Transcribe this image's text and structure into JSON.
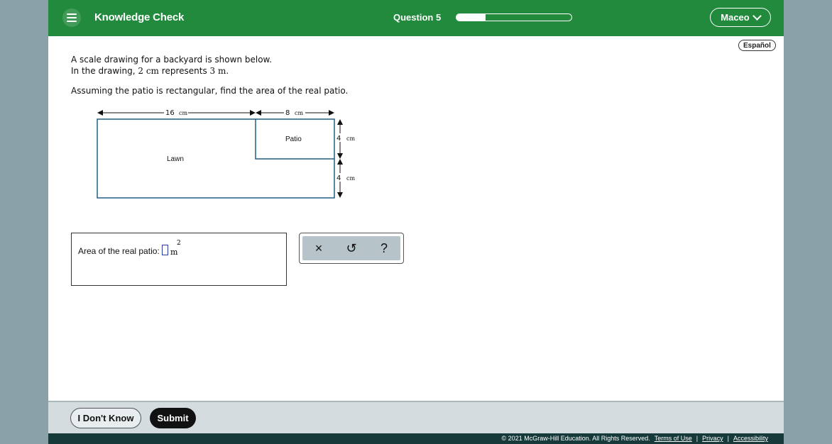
{
  "header": {
    "title": "Knowledge Check",
    "question_label": "Question 5",
    "progress": 0.25,
    "user_name": "Maceo"
  },
  "language_button": "Español",
  "problem": {
    "line1": "A scale drawing for a backyard is shown below.",
    "line2_prefix": "In the drawing,",
    "scale_drawing": "2 cm",
    "line2_middle": "represents",
    "scale_real": "3 m",
    "line2_suffix": ".",
    "question": "Assuming the patio is rectangular, find the area of the real patio."
  },
  "diagram": {
    "lawn_label": "Lawn",
    "patio_label": "Patio",
    "width_left_value": "16",
    "width_right_value": "8",
    "height_top_value": "4",
    "height_bottom_value": "4",
    "unit": "cm"
  },
  "answer": {
    "label": "Area of the real patio:",
    "value": "",
    "unit": "m",
    "exponent": "2"
  },
  "tools": {
    "clear": "×",
    "undo": "↺",
    "help": "?"
  },
  "footer": {
    "dont_know": "I Don't Know",
    "submit": "Submit",
    "copyright": "© 2021 McGraw-Hill Education. All Rights Reserved.",
    "terms": "Terms of Use",
    "privacy": "Privacy",
    "accessibility": "Accessibility"
  },
  "colors": {
    "header": "#228a3c",
    "diagram_stroke": "#1f5f86"
  }
}
